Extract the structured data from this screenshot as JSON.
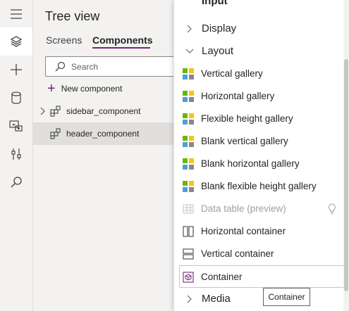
{
  "rail": {
    "items": [
      {
        "icon": "hamburger-icon",
        "active": false
      },
      {
        "icon": "layers-icon",
        "active": true
      },
      {
        "icon": "plus-icon",
        "active": false
      },
      {
        "icon": "database-icon",
        "active": false
      },
      {
        "icon": "media-icon",
        "active": false
      },
      {
        "icon": "tools-icon",
        "active": false
      },
      {
        "icon": "search-icon",
        "active": false
      }
    ]
  },
  "tree": {
    "title": "Tree view",
    "tabs": [
      {
        "label": "Screens",
        "active": false
      },
      {
        "label": "Components",
        "active": true
      }
    ],
    "search": {
      "placeholder": "Search"
    },
    "new_component_label": "New component",
    "rows": [
      {
        "label": "sidebar_component",
        "expandable": true,
        "selected": false
      },
      {
        "label": "header_component",
        "expandable": false,
        "selected": true
      }
    ]
  },
  "menu": {
    "partial_header": "Input",
    "sections": [
      {
        "label": "Display",
        "expanded": false
      },
      {
        "label": "Layout",
        "expanded": true
      },
      {
        "label": "Media",
        "expanded": false
      }
    ],
    "layout_items": [
      {
        "label": "Vertical gallery",
        "icon": "gallery-icon",
        "disabled": false
      },
      {
        "label": "Horizontal gallery",
        "icon": "gallery-icon",
        "disabled": false
      },
      {
        "label": "Flexible height gallery",
        "icon": "gallery-icon",
        "disabled": false
      },
      {
        "label": "Blank vertical gallery",
        "icon": "gallery-icon",
        "disabled": false
      },
      {
        "label": "Blank horizontal gallery",
        "icon": "gallery-icon",
        "disabled": false
      },
      {
        "label": "Blank flexible height gallery",
        "icon": "gallery-icon",
        "disabled": false
      },
      {
        "label": "Data table (preview)",
        "icon": "table-icon",
        "disabled": true
      },
      {
        "label": "Horizontal container",
        "icon": "horizontal-container-icon",
        "disabled": false
      },
      {
        "label": "Vertical container",
        "icon": "vertical-container-icon",
        "disabled": false
      },
      {
        "label": "Container",
        "icon": "container-icon",
        "disabled": false,
        "hovered": true
      }
    ],
    "tooltip": "Container"
  },
  "colors": {
    "accent": "#742774",
    "gallery_green": "#6bb700",
    "gallery_yellow": "#f2c811",
    "gallery_blue": "#4f9fd6",
    "gallery_gray": "#8a8886"
  }
}
